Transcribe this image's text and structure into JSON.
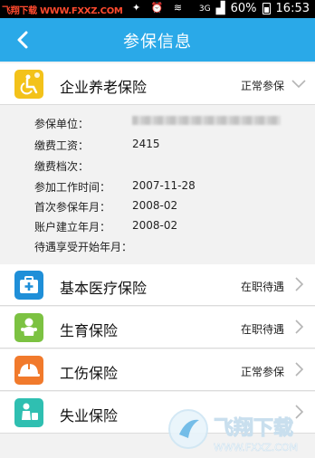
{
  "statusbar": {
    "watermark": "飞翔下载 WWW.FXXZ.COM",
    "network": "3G",
    "battery": "60%",
    "time": "16:53"
  },
  "header": {
    "title": "参保信息"
  },
  "rows": [
    {
      "name": "企业养老保险",
      "status": "正常参保",
      "icon": "wheelchair-icon",
      "color": "#f3c21a",
      "chevron": "chevron-down"
    },
    {
      "name": "基本医疗保险",
      "status": "在职待遇",
      "icon": "medical-kit-icon",
      "color": "#1f8fd8",
      "chevron": "chevron-right"
    },
    {
      "name": "生育保险",
      "status": "在职待遇",
      "icon": "baby-icon",
      "color": "#7cc242",
      "chevron": "chevron-right"
    },
    {
      "name": "工伤保险",
      "status": "正常参保",
      "icon": "helmet-icon",
      "color": "#f17a2c",
      "chevron": "chevron-right"
    },
    {
      "name": "失业保险",
      "status": "",
      "icon": "unemployed-icon",
      "color": "#2fbfb1",
      "chevron": "chevron-right"
    }
  ],
  "detail": {
    "labels": [
      "参保单位：",
      "缴费工资：",
      "缴费档次：",
      "参加工作时间：",
      "首次参保年月：",
      "账户建立年月：",
      "待遇享受开始年月："
    ],
    "values": [
      "",
      "2415",
      "",
      "2007-11-28",
      "2008-02",
      "2008-02",
      ""
    ]
  },
  "watermark_bottom": {
    "cn": "飞翔下载",
    "url": "WWW.FXXZ.COM"
  }
}
